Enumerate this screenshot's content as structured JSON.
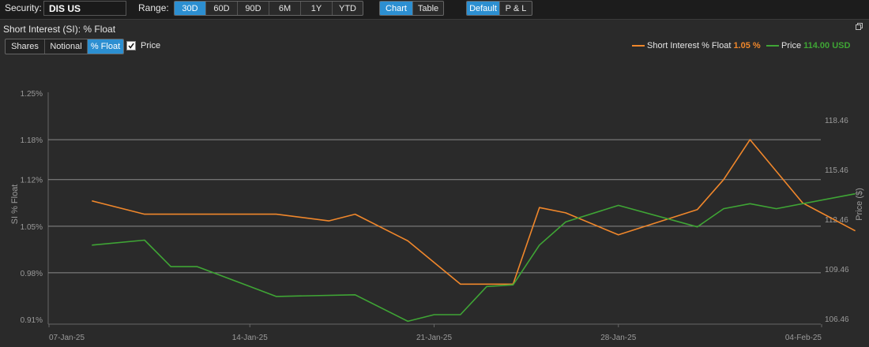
{
  "toolbar": {
    "security_label": "Security:",
    "security_value": "DIS US",
    "range_label": "Range:",
    "range_options": [
      "30D",
      "60D",
      "90D",
      "6M",
      "1Y",
      "YTD"
    ],
    "range_selected": "30D",
    "view_options": [
      "Chart",
      "Table"
    ],
    "view_selected": "Chart",
    "mode_options": [
      "Default",
      "P & L"
    ],
    "mode_selected": "Default"
  },
  "panel": {
    "title": "Short Interest (SI): % Float",
    "measure_options": [
      "Shares",
      "Notional",
      "% Float"
    ],
    "measure_selected": "% Float",
    "price_checkbox_label": "Price",
    "price_checked": true
  },
  "legend": {
    "si_label": "Short Interest % Float",
    "si_value": "1.05 %",
    "price_label": "Price",
    "price_value": "114.00 USD"
  },
  "colors": {
    "si": "#f0872b",
    "price": "#3fa535",
    "accent": "#2c8fd1"
  },
  "chart_data": {
    "type": "line",
    "x_ticks": [
      "07-Jan-25",
      "14-Jan-25",
      "21-Jan-25",
      "28-Jan-25",
      "04-Feb-25"
    ],
    "x_range": [
      "2025-01-07",
      "2025-02-04"
    ],
    "grid": true,
    "yleft": {
      "title": "SI % Float",
      "ticks": [
        "1.25%",
        "1.18%",
        "1.12%",
        "1.05%",
        "0.98%",
        "0.91%"
      ],
      "range": [
        0.91,
        1.25
      ]
    },
    "yright": {
      "title": "Price ($)",
      "ticks": [
        "118.46",
        "115.46",
        "112.46",
        "109.46",
        "106.46"
      ],
      "range": [
        106.46,
        118.46
      ]
    },
    "series": [
      {
        "name": "Short Interest % Float",
        "axis": "left",
        "points": [
          [
            "2025-01-08",
            1.088
          ],
          [
            "2025-01-10",
            1.068
          ],
          [
            "2025-01-15",
            1.068
          ],
          [
            "2025-01-17",
            1.058
          ],
          [
            "2025-01-18",
            1.068
          ],
          [
            "2025-01-20",
            1.028
          ],
          [
            "2025-01-22",
            0.963
          ],
          [
            "2025-01-24",
            0.963
          ],
          [
            "2025-01-25",
            1.078
          ],
          [
            "2025-01-26",
            1.07
          ],
          [
            "2025-01-28",
            1.037
          ],
          [
            "2025-01-31",
            1.075
          ],
          [
            "2025-02-01",
            1.12
          ],
          [
            "2025-02-02",
            1.18
          ],
          [
            "2025-02-04",
            1.085
          ],
          [
            "2025-02-05",
            1.064
          ],
          [
            "2025-02-06",
            1.043
          ]
        ]
      },
      {
        "name": "Price",
        "axis": "right",
        "points": [
          [
            "2025-01-08",
            110.9
          ],
          [
            "2025-01-10",
            111.2
          ],
          [
            "2025-01-11",
            109.6
          ],
          [
            "2025-01-12",
            109.6
          ],
          [
            "2025-01-14",
            108.4
          ],
          [
            "2025-01-15",
            107.8
          ],
          [
            "2025-01-18",
            107.9
          ],
          [
            "2025-01-20",
            106.3
          ],
          [
            "2025-01-21",
            106.7
          ],
          [
            "2025-01-22",
            106.7
          ],
          [
            "2025-01-23",
            108.4
          ],
          [
            "2025-01-24",
            108.5
          ],
          [
            "2025-01-25",
            110.9
          ],
          [
            "2025-01-26",
            112.3
          ],
          [
            "2025-01-28",
            113.3
          ],
          [
            "2025-01-31",
            112.0
          ],
          [
            "2025-02-01",
            113.1
          ],
          [
            "2025-02-02",
            113.4
          ],
          [
            "2025-02-03",
            113.1
          ],
          [
            "2025-02-06",
            114.0
          ]
        ]
      }
    ]
  }
}
